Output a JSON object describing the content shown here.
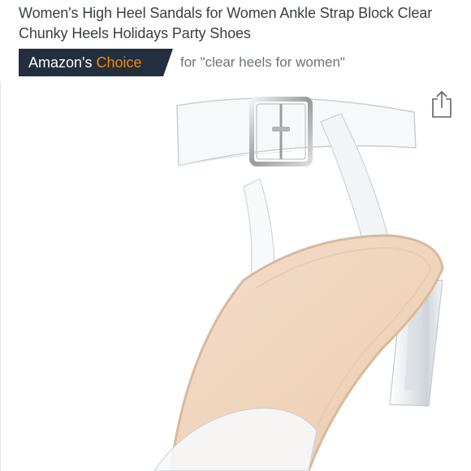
{
  "product": {
    "title": "Women's High Heel Sandals for Women Ankle Strap Block Clear Chunky Heels Holidays Party Shoes"
  },
  "badge": {
    "prefix": "Amazon's",
    "accent_word": "Choice",
    "query_text": "for \"clear heels for women\""
  },
  "icons": {
    "share": "share-icon"
  },
  "colors": {
    "badge_background": "#232f3e",
    "badge_accent": "#f08804",
    "title_text": "#3a3f44",
    "secondary_text": "#6c7378"
  }
}
